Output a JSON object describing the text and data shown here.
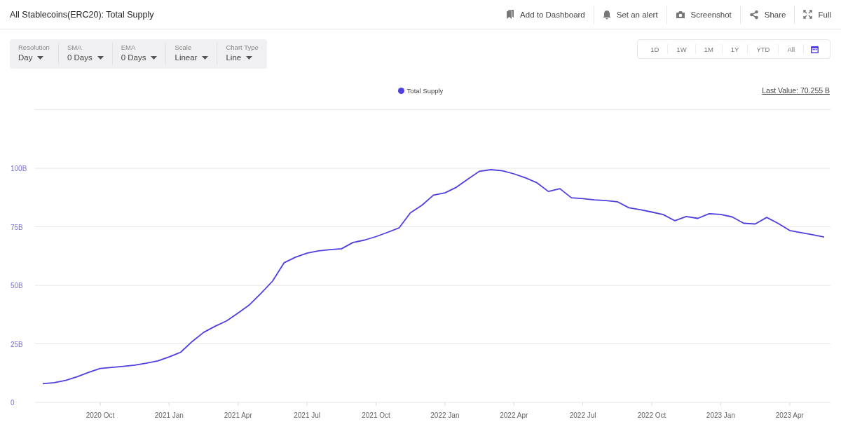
{
  "header": {
    "title": "All Stablecoins(ERC20): Total Supply",
    "actions": [
      {
        "kind": "dashboard",
        "label": "Add to Dashboard"
      },
      {
        "kind": "alert",
        "label": "Set an alert"
      },
      {
        "kind": "screenshot",
        "label": "Screenshot"
      },
      {
        "kind": "share",
        "label": "Share"
      },
      {
        "kind": "full",
        "label": "Full"
      }
    ]
  },
  "controls": [
    {
      "label": "Resolution",
      "value": "Day"
    },
    {
      "label": "SMA",
      "value": "0 Days"
    },
    {
      "label": "EMA",
      "value": "0 Days"
    },
    {
      "label": "Scale",
      "value": "Linear"
    },
    {
      "label": "Chart Type",
      "value": "Line"
    }
  ],
  "ranges": [
    "1D",
    "1W",
    "1M",
    "1Y",
    "YTD",
    "All"
  ],
  "chart": {
    "last_value": "Last Value: 70.255 B",
    "chart_data": {
      "type": "line",
      "grid": true,
      "ylim": [
        0,
        125
      ],
      "yticks": [
        {
          "value": 0,
          "label": "0"
        },
        {
          "value": 25,
          "label": "25B"
        },
        {
          "value": 50,
          "label": "50B"
        },
        {
          "value": 75,
          "label": "75B"
        },
        {
          "value": 100,
          "label": "100B"
        }
      ],
      "categories": [
        null,
        null,
        null,
        null,
        null,
        "2020 Oct",
        null,
        null,
        null,
        null,
        null,
        "2021 Jan",
        null,
        null,
        null,
        null,
        null,
        "2021 Apr",
        null,
        null,
        null,
        null,
        null,
        "2021 Jul",
        null,
        null,
        null,
        null,
        null,
        "2021 Oct",
        null,
        null,
        null,
        null,
        null,
        "2022 Jan",
        null,
        null,
        null,
        null,
        null,
        "2022 Apr",
        null,
        null,
        null,
        null,
        null,
        "2022 Jul",
        null,
        null,
        null,
        null,
        null,
        "2022 Oct",
        null,
        null,
        null,
        null,
        null,
        "2023 Jan",
        null,
        null,
        null,
        null,
        null,
        "2023 Apr",
        null,
        null,
        null
      ],
      "series": [
        {
          "name": "Total Supply",
          "color": "#4f3fe0",
          "values": [
            8.0,
            8.4,
            9.4,
            11.0,
            12.8,
            14.5,
            14.9,
            15.4,
            15.9,
            16.7,
            17.7,
            19.4,
            21.4,
            26.0,
            29.9,
            32.5,
            34.8,
            38.2,
            41.7,
            46.6,
            51.8,
            59.6,
            62.0,
            63.7,
            64.7,
            65.2,
            65.6,
            68.3,
            69.3,
            70.8,
            72.6,
            74.5,
            81.0,
            84.2,
            88.5,
            89.5,
            91.9,
            95.4,
            98.7,
            99.4,
            98.9,
            97.6,
            95.9,
            93.8,
            90.1,
            91.3,
            87.4,
            87.0,
            86.5,
            86.2,
            85.7,
            83.1,
            82.3,
            81.3,
            80.2,
            77.6,
            79.4,
            78.6,
            80.6,
            80.3,
            79.2,
            76.5,
            76.2,
            79.0,
            76.4,
            73.4,
            72.5,
            71.6,
            70.6
          ]
        }
      ]
    }
  }
}
